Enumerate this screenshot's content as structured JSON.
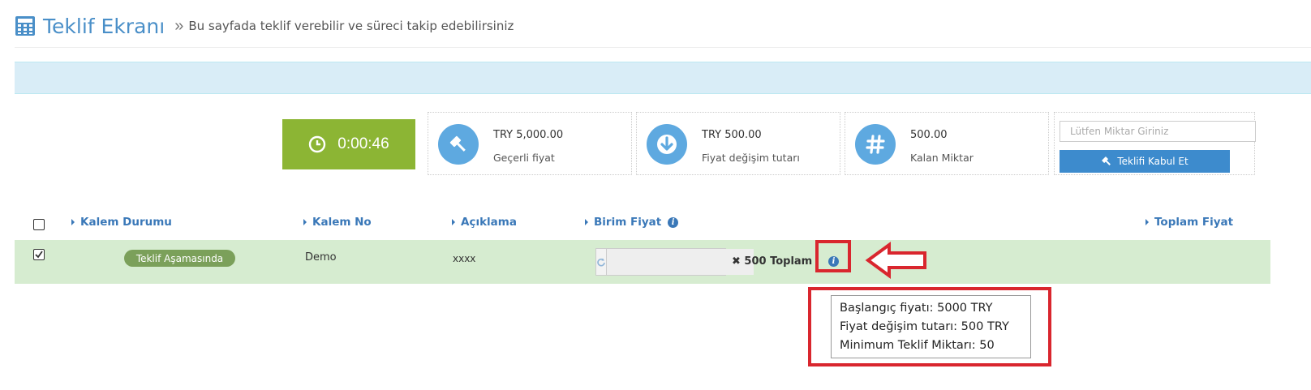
{
  "header": {
    "title": "Teklif Ekranı",
    "separator": "»",
    "subtitle": "Bu sayfada teklif verebilir ve süreci takip edebilirsiniz"
  },
  "timer": {
    "value": "0:00:46",
    "icon": "clock-icon",
    "color": "#8cb534"
  },
  "stats": [
    {
      "value": "TRY 5,000.00",
      "label": "Geçerli fiyat",
      "icon": "gavel-icon"
    },
    {
      "value": "TRY 500.00",
      "label": "Fiyat değişim tutarı",
      "icon": "arrow-down-icon"
    },
    {
      "value": "500.00",
      "label": "Kalan Miktar",
      "icon": "hash-icon"
    }
  ],
  "quantity": {
    "placeholder": "Lütfen Miktar Giriniz",
    "button_label": "Teklifi Kabul Et"
  },
  "table": {
    "headers": {
      "status": "Kalem Durumu",
      "item_no": "Kalem No",
      "desc": "Açıklama",
      "unit_price": "Birim Fiyat",
      "total": "Toplam Fiyat"
    },
    "rows": [
      {
        "status": "Teklif Aşamasında",
        "item_no": "Demo",
        "desc": "xxxx",
        "multiplier": "✖ 500 Toplam",
        "checked": true
      }
    ]
  },
  "tooltip": {
    "lines": [
      "Başlangıç fiyatı: 5000 TRY",
      "Fiyat değişim tutarı: 500 TRY",
      "Minimum Teklif Miktarı: 50"
    ]
  },
  "colors": {
    "accent": "#3a78b8",
    "row_bg": "#d6ecd0",
    "highlight": "#d9262e",
    "info_bar": "#d9edf7"
  }
}
